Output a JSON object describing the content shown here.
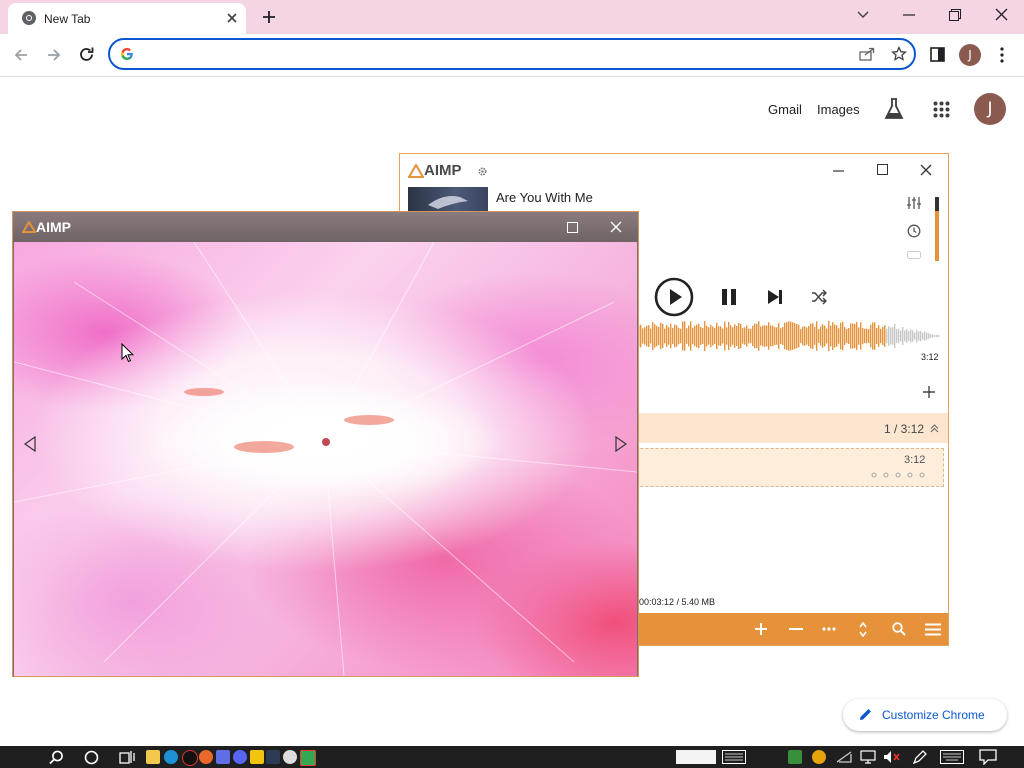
{
  "browser": {
    "tab_title": "New Tab",
    "omnibox_value": "",
    "profile_initial": "J"
  },
  "ntp": {
    "gmail": "Gmail",
    "images": "Images",
    "profile_initial": "J",
    "customize_label": "Customize Chrome"
  },
  "aimp_main": {
    "logo": "AIMP",
    "track_title": "Are You With Me",
    "time_right": "3:12",
    "playlist_count": "1 / 3:12",
    "playlist_item_duration": "3:12",
    "playlist_info": "00:03:12 / 5.40 MB",
    "waveform_progress": 0.82
  },
  "aimp_vis": {
    "logo": "AIMP"
  },
  "colors": {
    "tab_strip": "#f5d4e4",
    "accent_orange": "#e5923a",
    "omnibox_focus": "#0b57d0",
    "avatar": "#8a5a4e"
  }
}
